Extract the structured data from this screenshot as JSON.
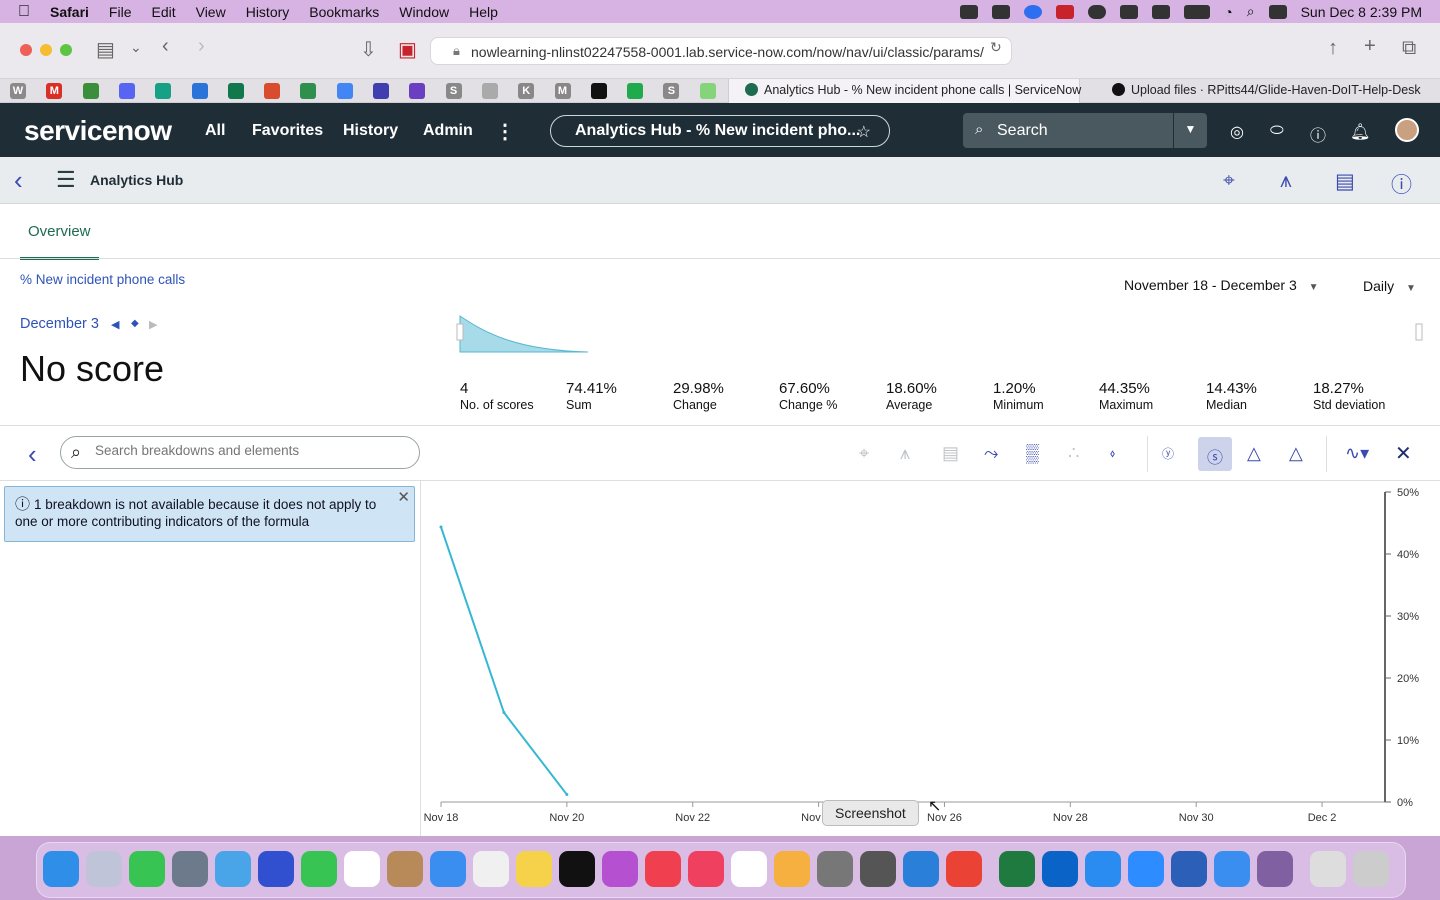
{
  "menubar": {
    "app": "Safari",
    "items": [
      "File",
      "Edit",
      "View",
      "History",
      "Bookmarks",
      "Window",
      "Help"
    ],
    "clock": "Sun Dec 8  2:39 PM"
  },
  "browser": {
    "url": "nowlearning-nlinst02247558-0001.lab.service-now.com/now/nav/ui/classic/params/",
    "tabs": [
      {
        "title": "Analytics Hub - % New incident phone calls | ServiceNow"
      },
      {
        "title": "Upload files · RPitts44/Glide-Haven-DoIT-Help-Desk"
      }
    ],
    "bookmark_icons": [
      "W",
      "M",
      "",
      "discord",
      "",
      "jira",
      "",
      "",
      "",
      "google-docs",
      "list",
      "",
      "S",
      "",
      "K",
      "M",
      "aws",
      "",
      "S",
      ""
    ]
  },
  "sn_header": {
    "logo": "servicenow",
    "nav": [
      "All",
      "Favorites",
      "History",
      "Admin"
    ],
    "more_icon": "more-vertical-icon",
    "page_pill": "Analytics Hub - % New incident pho...",
    "search_label": "Search"
  },
  "subheader": {
    "title": "Analytics Hub"
  },
  "overview": {
    "tab_label": "Overview",
    "indicator_link": "% New incident phone calls",
    "date_range": "November 18 - December 3",
    "frequency": "Daily",
    "date_nav": "December 3",
    "score_text": "No score",
    "stats": [
      {
        "value": "4",
        "label": "No. of scores"
      },
      {
        "value": "74.41%",
        "label": "Sum"
      },
      {
        "value": "29.98%",
        "label": "Change"
      },
      {
        "value": "67.60%",
        "label": "Change %"
      },
      {
        "value": "18.60%",
        "label": "Average"
      },
      {
        "value": "1.20%",
        "label": "Minimum"
      },
      {
        "value": "44.35%",
        "label": "Maximum"
      },
      {
        "value": "14.43%",
        "label": "Median"
      },
      {
        "value": "18.27%",
        "label": "Std deviation"
      }
    ]
  },
  "breakdown_panel": {
    "search_placeholder": "Search breakdowns and elements",
    "info_message": "1 breakdown is not available because it does not apply to one or more contributing indicators of the formula"
  },
  "chart_toolbar_icons": [
    "target-icon",
    "trend-icon",
    "comment-icon",
    "forecast-icon",
    "band-icon",
    "relations-icon",
    "tag-icon",
    "yoy-icon",
    "score-icon",
    "threshold-icon",
    "target-percent-icon",
    "chart-type-icon",
    "close-icon"
  ],
  "chart_data": {
    "type": "line",
    "x": [
      "Nov 18",
      "Nov 19",
      "Nov 20"
    ],
    "values": [
      44.35,
      14.43,
      1.2
    ],
    "xticks": [
      "Nov 18",
      "Nov 20",
      "Nov 22",
      "Nov 24",
      "Nov 26",
      "Nov 28",
      "Nov 30",
      "Dec 2"
    ],
    "yticks": [
      "0%",
      "10%",
      "20%",
      "30%",
      "40%",
      "50%"
    ],
    "ylim": [
      0,
      50
    ],
    "xlim_days": [
      "Nov 18",
      "Dec 3"
    ],
    "color": "#35b7d3",
    "grid": false
  },
  "tooltip": "Screenshot",
  "colors": {
    "sn_header": "#1f2e36",
    "accent_green": "#1d6c50",
    "link_blue": "#2e53b8"
  }
}
